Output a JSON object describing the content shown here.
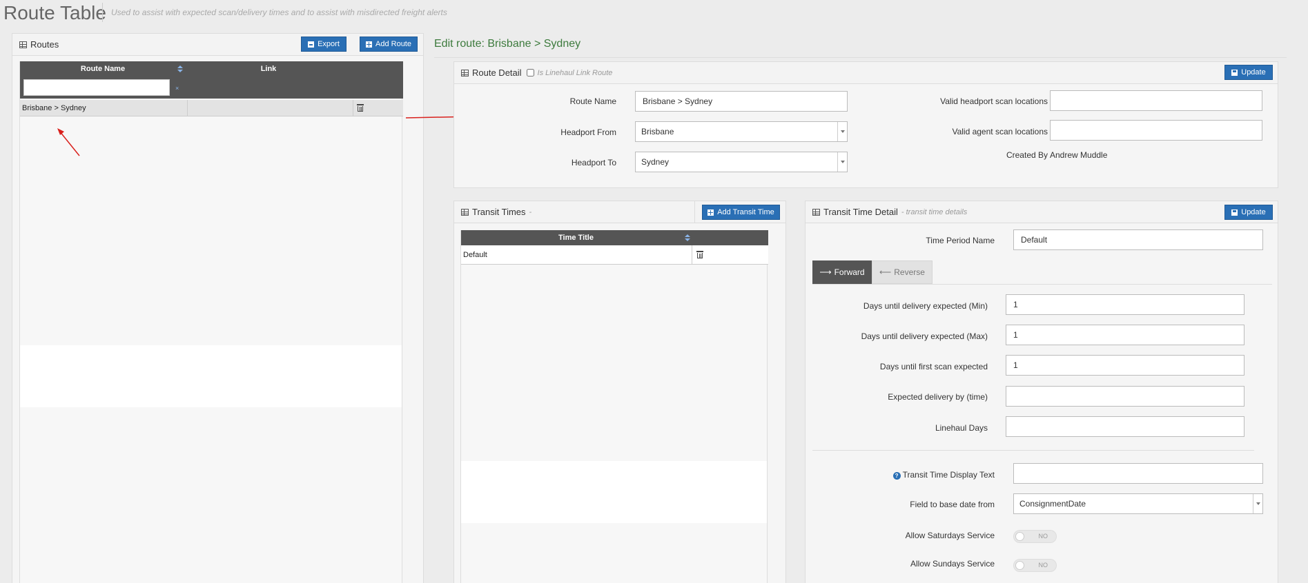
{
  "header": {
    "title": "Route Table",
    "subtitle": "Used to assist with expected scan/delivery times and to assist with misdirected freight alerts"
  },
  "routes_panel": {
    "title": "Routes",
    "export_label": "Export",
    "add_label": "Add Route",
    "columns": [
      "Route Name",
      "Link"
    ],
    "filter_value": "",
    "rows": [
      {
        "name": "Brisbane > Sydney",
        "link": ""
      }
    ]
  },
  "edit_heading": "Edit route: Brisbane > Sydney",
  "route_detail": {
    "title": "Route Detail",
    "linehaul_checkbox_label": "Is Linehaul Link Route",
    "linehaul_checked": false,
    "update_label": "Update",
    "route_name_label": "Route Name",
    "route_name_value": "Brisbane > Sydney",
    "headport_from_label": "Headport From",
    "headport_from_value": "Brisbane",
    "headport_to_label": "Headport To",
    "headport_to_value": "Sydney",
    "valid_headport_label": "Valid headport scan locations",
    "valid_headport_value": "",
    "valid_agent_label": "Valid agent scan locations",
    "valid_agent_value": "",
    "created_by_label": "Created By",
    "created_by_value": "Andrew Muddle"
  },
  "transit_times": {
    "title": "Transit Times",
    "title_suffix": "-",
    "add_label": "Add Transit Time",
    "column": "Time Title",
    "rows": [
      {
        "title": "Default"
      }
    ]
  },
  "transit_detail": {
    "title": "Transit Time Detail",
    "subtitle": "- transit time details",
    "update_label": "Update",
    "period_name_label": "Time Period Name",
    "period_name_value": "Default",
    "tabs": {
      "forward": "Forward",
      "reverse": "Reverse"
    },
    "min_label": "Days until delivery expected (Min)",
    "min_value": "1",
    "max_label": "Days until delivery expected (Max)",
    "max_value": "1",
    "first_scan_label": "Days until first scan expected",
    "first_scan_value": "1",
    "expected_time_label": "Expected delivery by (time)",
    "expected_time_value": "",
    "linehaul_days_label": "Linehaul Days",
    "linehaul_days_value": "",
    "display_text_label": "Transit Time Display Text",
    "display_text_value": "",
    "base_date_label": "Field to base date from",
    "base_date_value": "ConsignmentDate",
    "saturday_label": "Allow Saturdays Service",
    "saturday_state": "NO",
    "sunday_label": "Allow Sundays Service",
    "sunday_state": "NO"
  },
  "colors": {
    "accent": "#2a6fb5",
    "heading_green": "#3c7a3c",
    "grid_header": "#555555",
    "annotation_arrow": "#d9201c"
  }
}
